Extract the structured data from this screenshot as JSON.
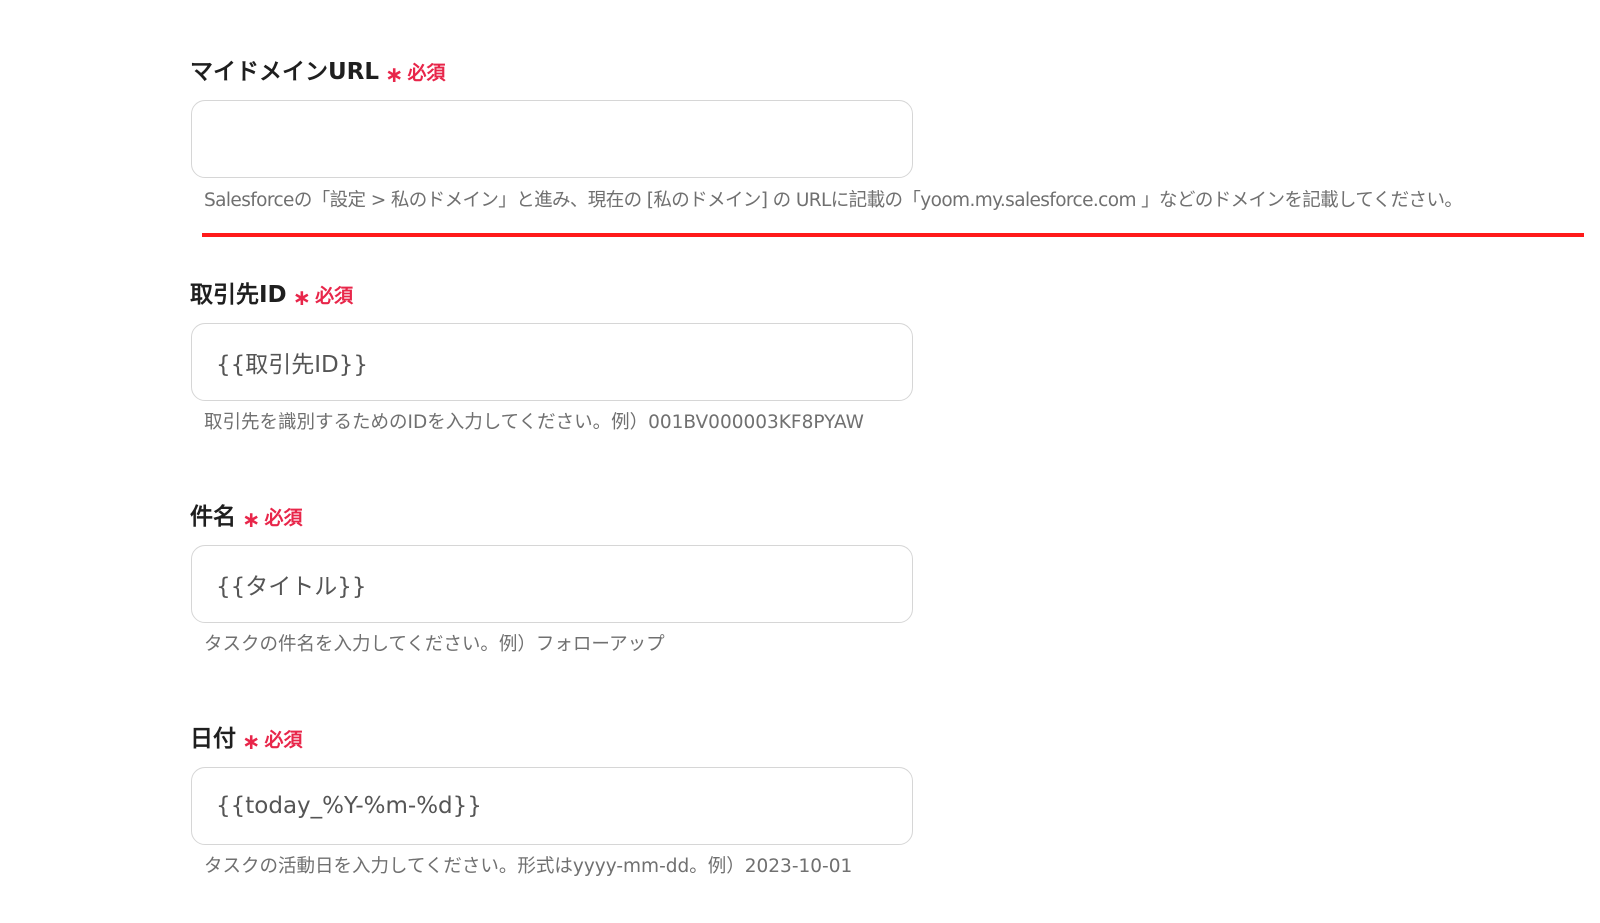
{
  "colors": {
    "required": "#e8264a",
    "annotation": "#ff1a1a",
    "border": "#d6d6d6"
  },
  "required_mark": "∗",
  "required_label": "必須",
  "fields": [
    {
      "label": "マイドメインURL",
      "value": "",
      "help": "Salesforceの「設定 > 私のドメイン」と進み、現在の [私のドメイン] の URLに記載の「yoom.my.salesforce.com 」などのドメインを記載してください。"
    },
    {
      "label": "取引先ID",
      "value": "{{取引先ID}}",
      "help": "取引先を識別するためのIDを入力してください。例）001BV000003KF8PYAW"
    },
    {
      "label": "件名",
      "value": "{{タイトル}}",
      "help": "タスクの件名を入力してください。例）フォローアップ"
    },
    {
      "label": "日付",
      "value": "{{today_%Y-%m-%d}}",
      "help": "タスクの活動日を入力してください。形式はyyyy-mm-dd。例）2023-10-01"
    }
  ]
}
